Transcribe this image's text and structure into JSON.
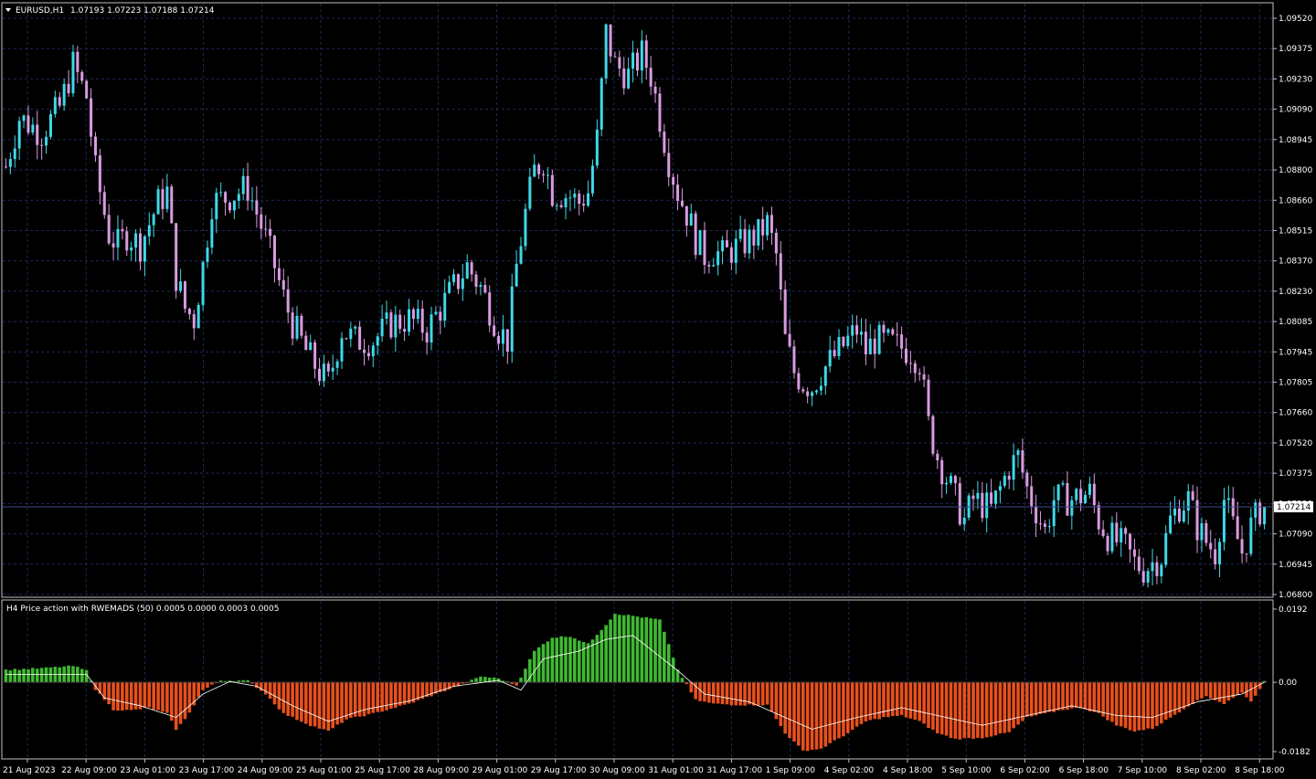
{
  "title": {
    "symbol": "EURUSD,H1",
    "ohlc": "1.07193 1.07223 1.07188 1.07214"
  },
  "indicator": {
    "label": "H4 Price action with RWEMADS (50) 0.0005 0.0000 0.0003 0.0005"
  },
  "colors": {
    "background": "#000000",
    "grid": "#1f2a5a",
    "bull": "#3fd8e8",
    "bear": "#d99be0",
    "hist_pos": "#40b832",
    "hist_neg": "#e8501e",
    "signal": "#ffffff"
  },
  "chart_data": [
    {
      "type": "candlestick",
      "ylim": [
        1.068,
        1.0952
      ],
      "yticks": [
        "1.09520",
        "1.09375",
        "1.09230",
        "1.09090",
        "1.08945",
        "1.08800",
        "1.08660",
        "1.08515",
        "1.08370",
        "1.08230",
        "1.08085",
        "1.07945",
        "1.07805",
        "1.07660",
        "1.07520",
        "1.07375",
        "1.07230",
        "1.07090",
        "1.06945",
        "1.06800"
      ],
      "xticks": [
        "21 Aug 2023",
        "22 Aug 09:00",
        "23 Aug 01:00",
        "23 Aug 17:00",
        "24 Aug 09:00",
        "25 Aug 01:00",
        "25 Aug 17:00",
        "28 Aug 09:00",
        "29 Aug 01:00",
        "29 Aug 17:00",
        "30 Aug 09:00",
        "31 Aug 01:00",
        "31 Aug 17:00",
        "1 Sep 09:00",
        "4 Sep 02:00",
        "4 Sep 18:00",
        "5 Sep 10:00",
        "6 Sep 02:00",
        "6 Sep 18:00",
        "7 Sep 10:00",
        "8 Sep 02:00",
        "8 Sep 18:00"
      ],
      "current_price": "1.07214",
      "current_value": 1.07214,
      "close_path": [
        [
          0,
          1.0882
        ],
        [
          3,
          1.0905
        ],
        [
          8,
          1.0898
        ],
        [
          12,
          1.091
        ],
        [
          15,
          1.093
        ],
        [
          18,
          1.0915
        ],
        [
          20,
          1.088
        ],
        [
          23,
          1.085
        ],
        [
          25,
          1.0845
        ],
        [
          27,
          1.085
        ],
        [
          30,
          1.0845
        ],
        [
          34,
          1.0865
        ],
        [
          36,
          1.087
        ],
        [
          38,
          1.083
        ],
        [
          40,
          1.0815
        ],
        [
          42,
          1.081
        ],
        [
          44,
          1.0835
        ],
        [
          46,
          1.0865
        ],
        [
          50,
          1.0868
        ],
        [
          54,
          1.0872
        ],
        [
          56,
          1.086
        ],
        [
          58,
          1.0848
        ],
        [
          60,
          1.0835
        ],
        [
          62,
          1.082
        ],
        [
          64,
          1.0808
        ],
        [
          67,
          1.0795
        ],
        [
          70,
          1.0785
        ],
        [
          72,
          1.078
        ],
        [
          75,
          1.0805
        ],
        [
          78,
          1.08
        ],
        [
          82,
          1.08
        ],
        [
          86,
          1.0808
        ],
        [
          90,
          1.081
        ],
        [
          94,
          1.0805
        ],
        [
          97,
          1.0815
        ],
        [
          100,
          1.0825
        ],
        [
          103,
          1.0835
        ],
        [
          106,
          1.0825
        ],
        [
          108,
          1.0815
        ],
        [
          110,
          1.0805
        ],
        [
          112,
          1.08
        ],
        [
          114,
          1.0835
        ],
        [
          116,
          1.086
        ],
        [
          118,
          1.088
        ],
        [
          120,
          1.0885
        ],
        [
          122,
          1.087
        ],
        [
          126,
          1.0868
        ],
        [
          128,
          1.0865
        ],
        [
          130,
          1.087
        ],
        [
          132,
          1.0895
        ],
        [
          134,
          1.0945
        ],
        [
          136,
          1.093
        ],
        [
          139,
          1.0925
        ],
        [
          142,
          1.0935
        ],
        [
          144,
          1.0925
        ],
        [
          146,
          1.0905
        ],
        [
          148,
          1.0885
        ],
        [
          150,
          1.087
        ],
        [
          152,
          1.086
        ],
        [
          154,
          1.0848
        ],
        [
          156,
          1.084
        ],
        [
          158,
          1.0842
        ],
        [
          160,
          1.084
        ],
        [
          164,
          1.0845
        ],
        [
          168,
          1.085
        ],
        [
          170,
          1.0855
        ],
        [
          172,
          1.084
        ],
        [
          174,
          1.08
        ],
        [
          176,
          1.0785
        ],
        [
          178,
          1.078
        ],
        [
          180,
          1.0778
        ],
        [
          182,
          1.0785
        ],
        [
          184,
          1.079
        ],
        [
          186,
          1.0795
        ],
        [
          188,
          1.08
        ],
        [
          190,
          1.0805
        ],
        [
          192,
          1.0795
        ],
        [
          194,
          1.08
        ],
        [
          198,
          1.0798
        ],
        [
          202,
          1.0795
        ],
        [
          204,
          1.079
        ],
        [
          206,
          1.076
        ],
        [
          208,
          1.0745
        ],
        [
          210,
          1.0735
        ],
        [
          212,
          1.0725
        ],
        [
          214,
          1.0715
        ],
        [
          216,
          1.0725
        ],
        [
          220,
          1.072
        ],
        [
          222,
          1.073
        ],
        [
          224,
          1.074
        ],
        [
          226,
          1.0745
        ],
        [
          228,
          1.073
        ],
        [
          230,
          1.072
        ],
        [
          232,
          1.071
        ],
        [
          234,
          1.0725
        ],
        [
          238,
          1.0725
        ],
        [
          242,
          1.0728
        ],
        [
          244,
          1.0715
        ],
        [
          246,
          1.0708
        ],
        [
          248,
          1.0705
        ],
        [
          250,
          1.0702
        ],
        [
          252,
          1.0695
        ],
        [
          254,
          1.0692
        ],
        [
          256,
          1.0695
        ],
        [
          258,
          1.0698
        ],
        [
          260,
          1.0715
        ],
        [
          262,
          1.0722
        ],
        [
          264,
          1.0725
        ],
        [
          266,
          1.0712
        ],
        [
          268,
          1.0705
        ],
        [
          270,
          1.07
        ],
        [
          272,
          1.0725
        ],
        [
          274,
          1.0712
        ],
        [
          276,
          1.07
        ],
        [
          278,
          1.0712
        ],
        [
          280,
          1.072
        ],
        [
          281,
          1.07214
        ]
      ]
    },
    {
      "type": "histogram",
      "ylim": [
        -0.0182,
        0.0192
      ],
      "yticks": [
        "0.0192",
        "0.00",
        "-0.0182"
      ],
      "hist_path": [
        [
          0,
          0.0032
        ],
        [
          8,
          0.0036
        ],
        [
          15,
          0.0042
        ],
        [
          18,
          0.003
        ],
        [
          20,
          -0.0018
        ],
        [
          24,
          -0.007
        ],
        [
          28,
          -0.0072
        ],
        [
          32,
          -0.0065
        ],
        [
          36,
          -0.008
        ],
        [
          38,
          -0.012
        ],
        [
          40,
          -0.0095
        ],
        [
          44,
          -0.002
        ],
        [
          48,
          0.0005
        ],
        [
          54,
          0.0004
        ],
        [
          58,
          -0.003
        ],
        [
          62,
          -0.008
        ],
        [
          68,
          -0.011
        ],
        [
          72,
          -0.0125
        ],
        [
          76,
          -0.0095
        ],
        [
          82,
          -0.008
        ],
        [
          90,
          -0.0055
        ],
        [
          96,
          -0.003
        ],
        [
          102,
          -0.0005
        ],
        [
          106,
          0.0015
        ],
        [
          110,
          0.001
        ],
        [
          114,
          -0.0008
        ],
        [
          118,
          0.008
        ],
        [
          122,
          0.0115
        ],
        [
          126,
          0.0118
        ],
        [
          130,
          0.0098
        ],
        [
          134,
          0.0148
        ],
        [
          136,
          0.0176
        ],
        [
          140,
          0.017
        ],
        [
          146,
          0.016
        ],
        [
          150,
          0.0032
        ],
        [
          154,
          -0.0045
        ],
        [
          158,
          -0.0055
        ],
        [
          164,
          -0.0058
        ],
        [
          170,
          -0.0058
        ],
        [
          174,
          -0.013
        ],
        [
          178,
          -0.0175
        ],
        [
          182,
          -0.017
        ],
        [
          188,
          -0.013
        ],
        [
          192,
          -0.01
        ],
        [
          196,
          -0.009
        ],
        [
          200,
          -0.0085
        ],
        [
          204,
          -0.01
        ],
        [
          208,
          -0.013
        ],
        [
          212,
          -0.0145
        ],
        [
          218,
          -0.0142
        ],
        [
          224,
          -0.0128
        ],
        [
          228,
          -0.009
        ],
        [
          232,
          -0.008
        ],
        [
          236,
          -0.007
        ],
        [
          240,
          -0.0065
        ],
        [
          244,
          -0.008
        ],
        [
          248,
          -0.011
        ],
        [
          252,
          -0.0125
        ],
        [
          256,
          -0.0118
        ],
        [
          260,
          -0.009
        ],
        [
          264,
          -0.006
        ],
        [
          268,
          -0.0035
        ],
        [
          272,
          -0.0055
        ],
        [
          276,
          -0.0025
        ],
        [
          278,
          -0.005
        ],
        [
          281,
          0.0002
        ]
      ],
      "signal_path": [
        [
          0,
          0.002
        ],
        [
          18,
          0.002
        ],
        [
          22,
          -0.004
        ],
        [
          30,
          -0.006
        ],
        [
          38,
          -0.009
        ],
        [
          44,
          -0.003
        ],
        [
          50,
          0.0002
        ],
        [
          56,
          -0.001
        ],
        [
          64,
          -0.006
        ],
        [
          72,
          -0.01
        ],
        [
          80,
          -0.007
        ],
        [
          90,
          -0.0048
        ],
        [
          100,
          -0.001
        ],
        [
          110,
          0.0005
        ],
        [
          115,
          -0.002
        ],
        [
          120,
          0.006
        ],
        [
          128,
          0.008
        ],
        [
          134,
          0.011
        ],
        [
          140,
          0.012
        ],
        [
          150,
          0.003
        ],
        [
          156,
          -0.003
        ],
        [
          166,
          -0.005
        ],
        [
          174,
          -0.009
        ],
        [
          180,
          -0.012
        ],
        [
          190,
          -0.009
        ],
        [
          200,
          -0.0065
        ],
        [
          210,
          -0.009
        ],
        [
          218,
          -0.011
        ],
        [
          228,
          -0.0085
        ],
        [
          238,
          -0.006
        ],
        [
          248,
          -0.0085
        ],
        [
          256,
          -0.009
        ],
        [
          266,
          -0.005
        ],
        [
          276,
          -0.003
        ],
        [
          281,
          0.0
        ]
      ]
    }
  ]
}
